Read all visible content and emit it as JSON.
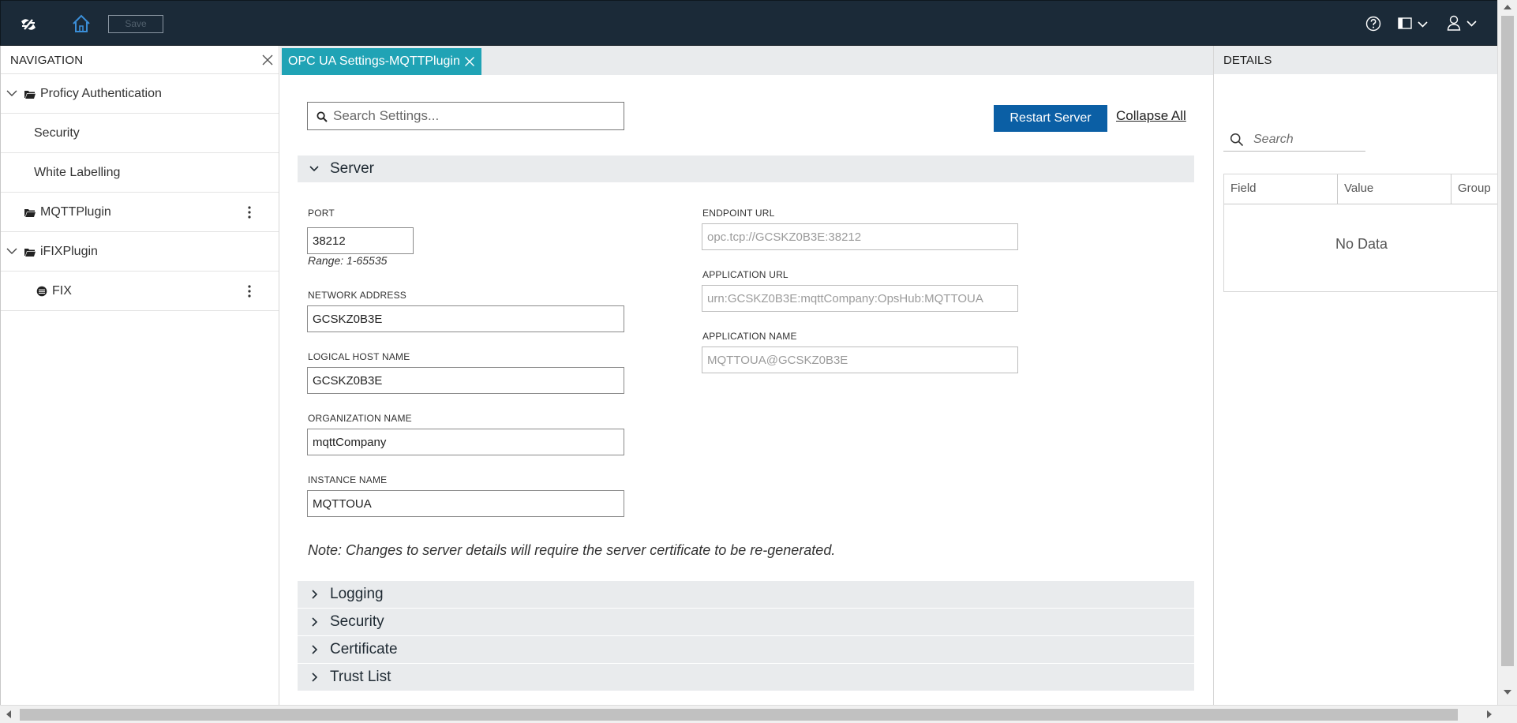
{
  "colors": {
    "topbar_bg": "#1b2a38",
    "accent_tab": "#20a3b5",
    "primary_button": "#0b5fa5",
    "section_header_bg": "#e9ebed"
  },
  "topbar": {
    "logo_icon": "app-logo-icon",
    "home_icon": "home-icon",
    "save_label": "Save",
    "help_icon": "help-icon",
    "layout_icon": "layout-panel-icon",
    "user_icon": "user-icon"
  },
  "navigation": {
    "title": "NAVIGATION",
    "items": [
      {
        "label": "Proficy Authentication",
        "type": "folder",
        "expanded": true
      },
      {
        "label": "Security",
        "type": "child"
      },
      {
        "label": "White Labelling",
        "type": "child"
      },
      {
        "label": "MQTTPlugin",
        "type": "folder",
        "expanded": false
      },
      {
        "label": "iFIXPlugin",
        "type": "folder",
        "expanded": true
      },
      {
        "label": "FIX",
        "type": "database"
      }
    ]
  },
  "tab": {
    "label": "OPC UA Settings-MQTTPlugin"
  },
  "main": {
    "search_placeholder": "Search Settings...",
    "restart_label": "Restart Server",
    "collapse_label": "Collapse All",
    "server": {
      "title": "Server",
      "port_label": "PORT",
      "port_value": "38212",
      "port_range": "Range: 1-65535",
      "network_label": "NETWORK ADDRESS",
      "network_value": "GCSKZ0B3E",
      "logical_label": "LOGICAL HOST NAME",
      "logical_value": "GCSKZ0B3E",
      "org_label": "ORGANIZATION NAME",
      "org_value": "mqttCompany",
      "instance_label": "INSTANCE NAME",
      "instance_value": "MQTTOUA",
      "endpoint_label": "ENDPOINT URL",
      "endpoint_value": "opc.tcp://GCSKZ0B3E:38212",
      "appurl_label": "APPLICATION URL",
      "appurl_value": "urn:GCSKZ0B3E:mqttCompany:OpsHub:MQTTOUA",
      "appname_label": "APPLICATION NAME",
      "appname_value": "MQTTOUA@GCSKZ0B3E",
      "note": "Note: Changes to server details will require the server certificate to be re-generated."
    },
    "sections": {
      "logging": "Logging",
      "security": "Security",
      "certificate": "Certificate",
      "trustlist": "Trust List"
    }
  },
  "details": {
    "title": "DETAILS",
    "search_placeholder": "Search",
    "columns": [
      "Field",
      "Value",
      "Group"
    ],
    "empty_text": "No Data"
  }
}
